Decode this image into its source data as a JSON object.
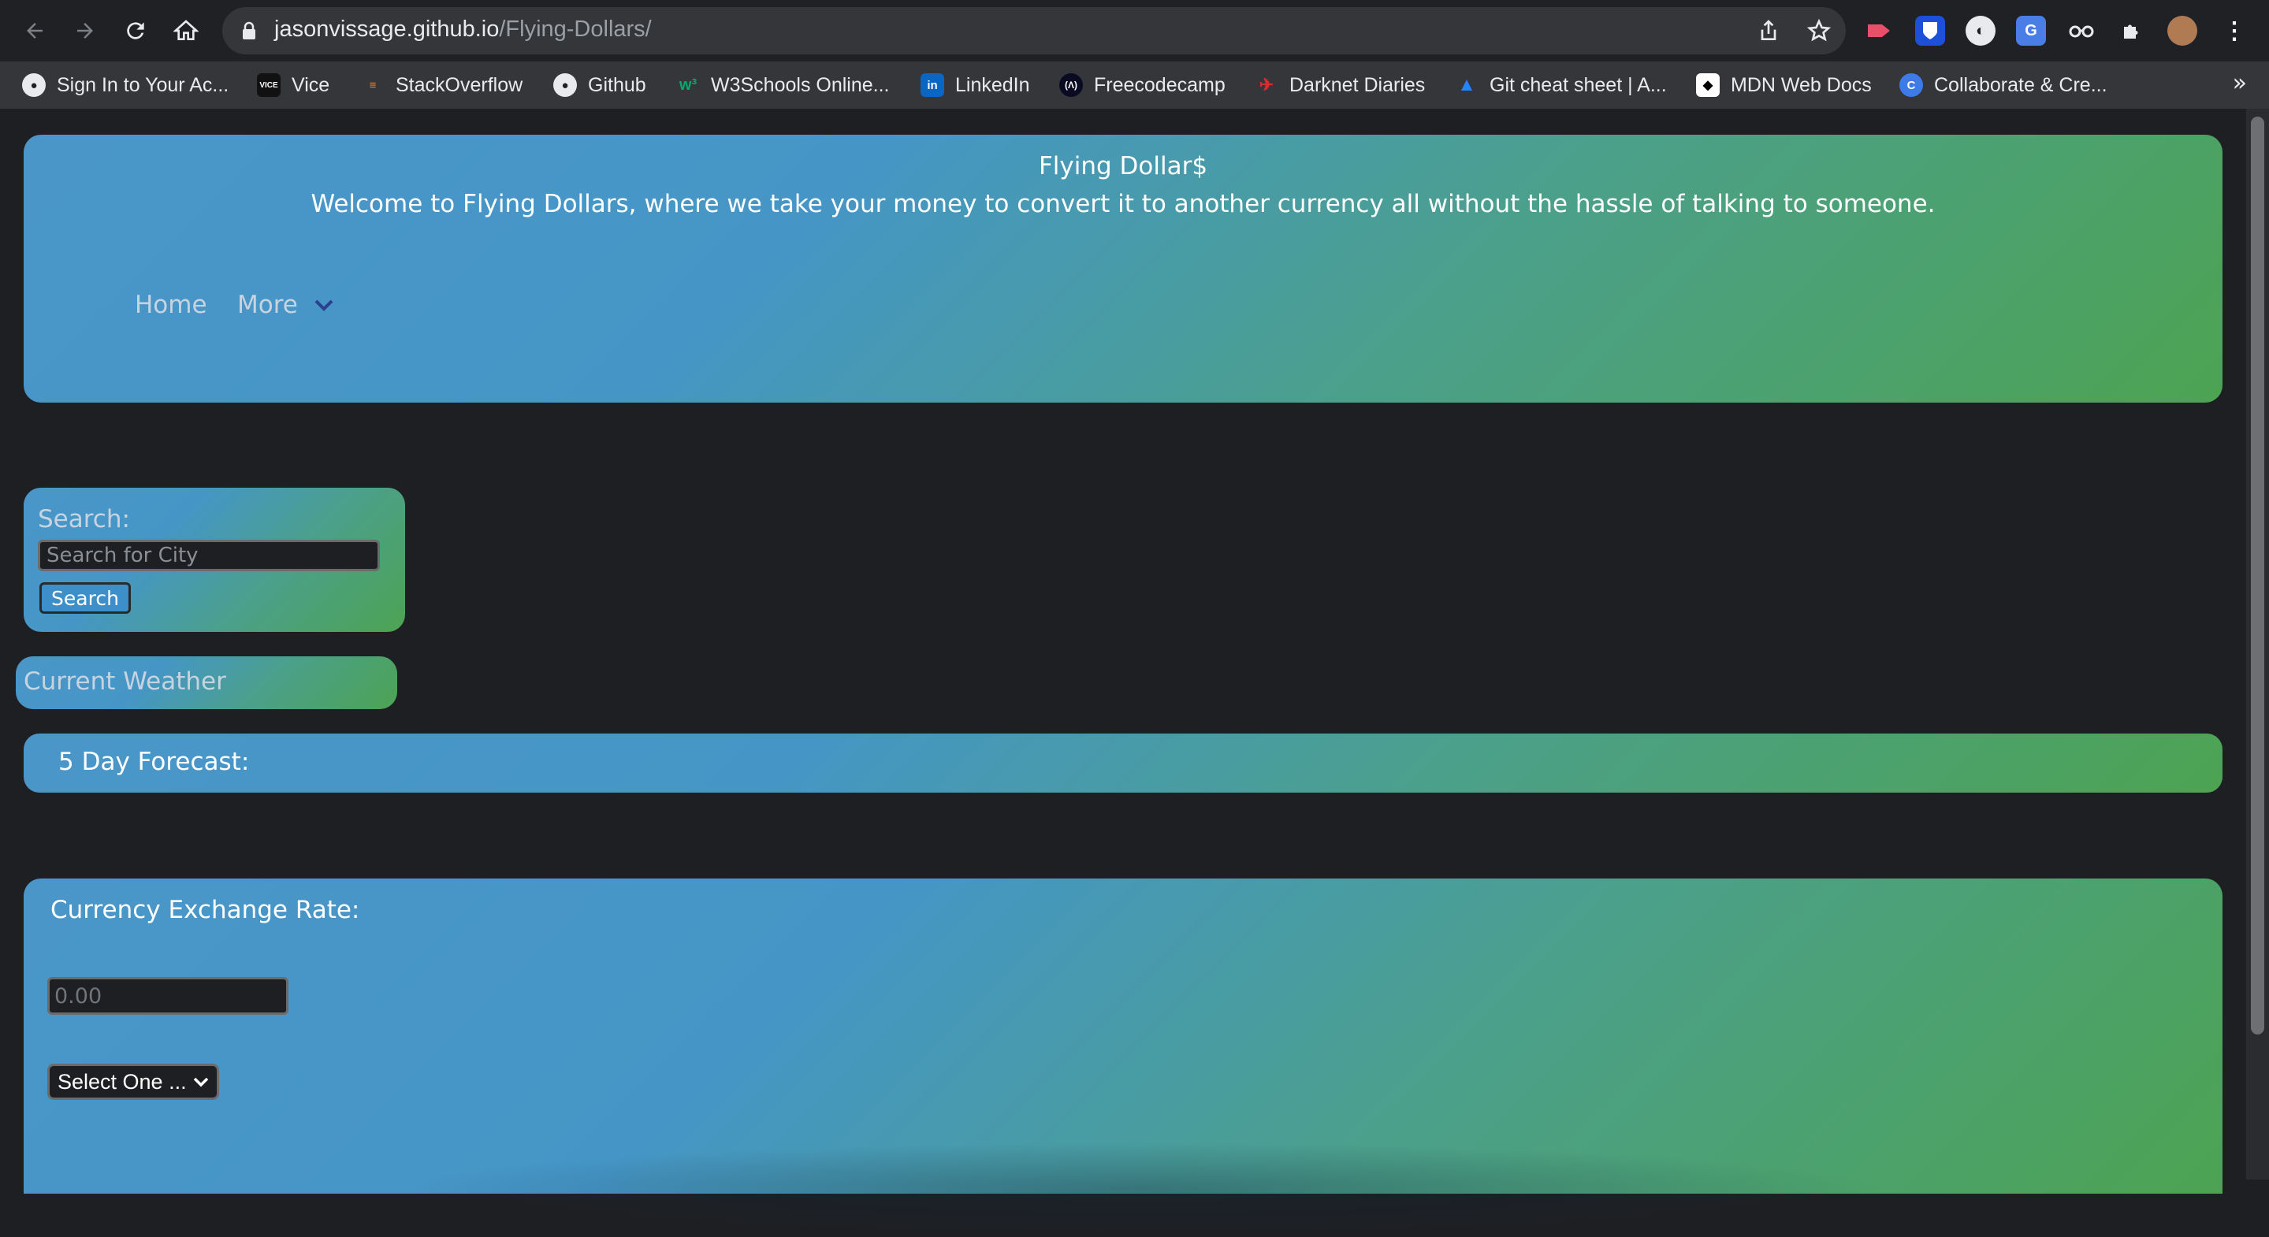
{
  "browser": {
    "url_host": "jasonvissage.github.io",
    "url_path": "/Flying-Dollars/",
    "bookmarks": [
      {
        "label": "Sign In to Your Ac...",
        "icon": "globe-icon"
      },
      {
        "label": "Vice",
        "icon": "vice-icon"
      },
      {
        "label": "StackOverflow",
        "icon": "stackoverflow-icon"
      },
      {
        "label": "Github",
        "icon": "github-icon"
      },
      {
        "label": "W3Schools Online...",
        "icon": "w3schools-icon"
      },
      {
        "label": "LinkedIn",
        "icon": "linkedin-icon"
      },
      {
        "label": "Freecodecamp",
        "icon": "freecodecamp-icon"
      },
      {
        "label": "Darknet Diaries",
        "icon": "darknet-diaries-icon"
      },
      {
        "label": "Git cheat sheet | A...",
        "icon": "atlassian-icon"
      },
      {
        "label": "MDN Web Docs",
        "icon": "mdn-icon"
      },
      {
        "label": "Collaborate & Cre...",
        "icon": "canva-icon"
      }
    ],
    "bookmarks_overflow": "»"
  },
  "header": {
    "title": "Flying Dollar$",
    "subtitle": "Welcome to Flying Dollars, where we take your money to convert it to another currency all without the hassle of talking to someone.",
    "nav": {
      "home": "Home",
      "more": "More"
    }
  },
  "search": {
    "label": "Search:",
    "placeholder": "Search for City",
    "button": "Search"
  },
  "weather": {
    "label": "Current Weather"
  },
  "forecast": {
    "label": "5 Day Forecast:"
  },
  "currency": {
    "label": "Currency Exchange Rate:",
    "amount_placeholder": "0.00",
    "select_value": "Select One ..."
  },
  "colors": {
    "gradient_start": "#4a96c9",
    "gradient_end": "#4da352",
    "page_bg": "#1e1f22"
  }
}
